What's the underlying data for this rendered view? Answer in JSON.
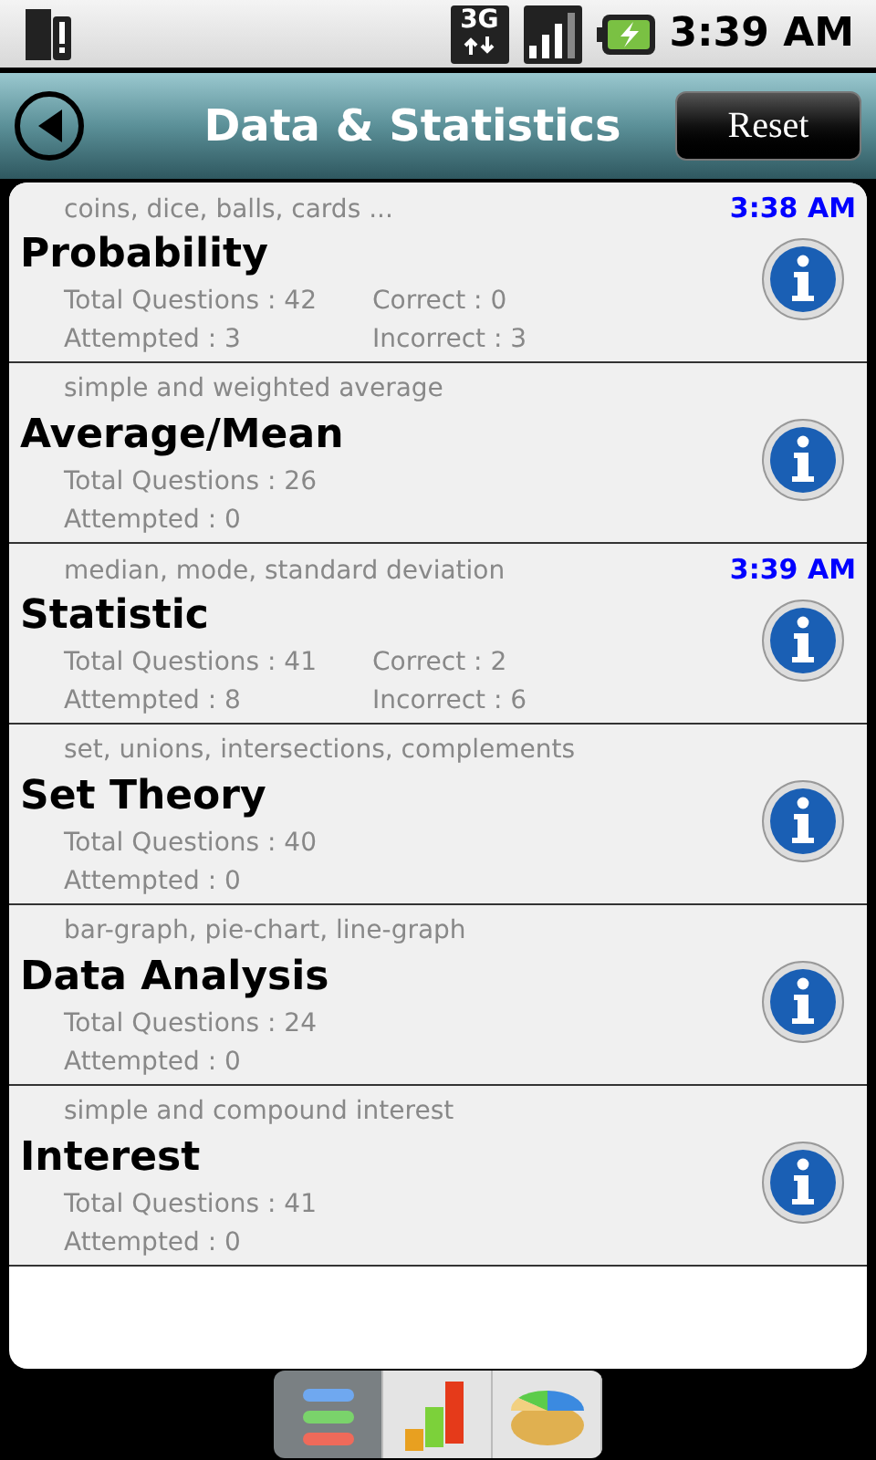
{
  "status_bar": {
    "time": "3:39 AM",
    "network": "3G"
  },
  "header": {
    "title": "Data & Statistics",
    "reset_button": "Reset"
  },
  "topics": [
    {
      "hint": "coins, dice, balls, cards ...",
      "title": "Probability",
      "time": "3:38 AM",
      "total": "Total Questions : 42",
      "attempted": "Attempted : 3",
      "correct": "Correct : 0",
      "incorrect": "Incorrect : 3"
    },
    {
      "hint": "simple and weighted average",
      "title": "Average/Mean",
      "total": "Total Questions : 26",
      "attempted": "Attempted : 0"
    },
    {
      "hint": "median, mode, standard deviation",
      "title": "Statistic",
      "time": "3:39 AM",
      "total": "Total Questions : 41",
      "attempted": "Attempted : 8",
      "correct": "Correct : 2",
      "incorrect": "Incorrect : 6"
    },
    {
      "hint": "set, unions, intersections, complements",
      "title": "Set Theory",
      "total": "Total Questions : 40",
      "attempted": "Attempted : 0"
    },
    {
      "hint": "bar-graph, pie-chart, line-graph",
      "title": "Data Analysis",
      "total": "Total Questions : 24",
      "attempted": "Attempted : 0"
    },
    {
      "hint": "simple and compound interest",
      "title": "Interest",
      "total": "Total Questions : 41",
      "attempted": "Attempted : 0"
    }
  ],
  "bottom_tabs": [
    {
      "kind": "list",
      "selected": true
    },
    {
      "kind": "bars",
      "selected": false
    },
    {
      "kind": "pie",
      "selected": false
    }
  ]
}
